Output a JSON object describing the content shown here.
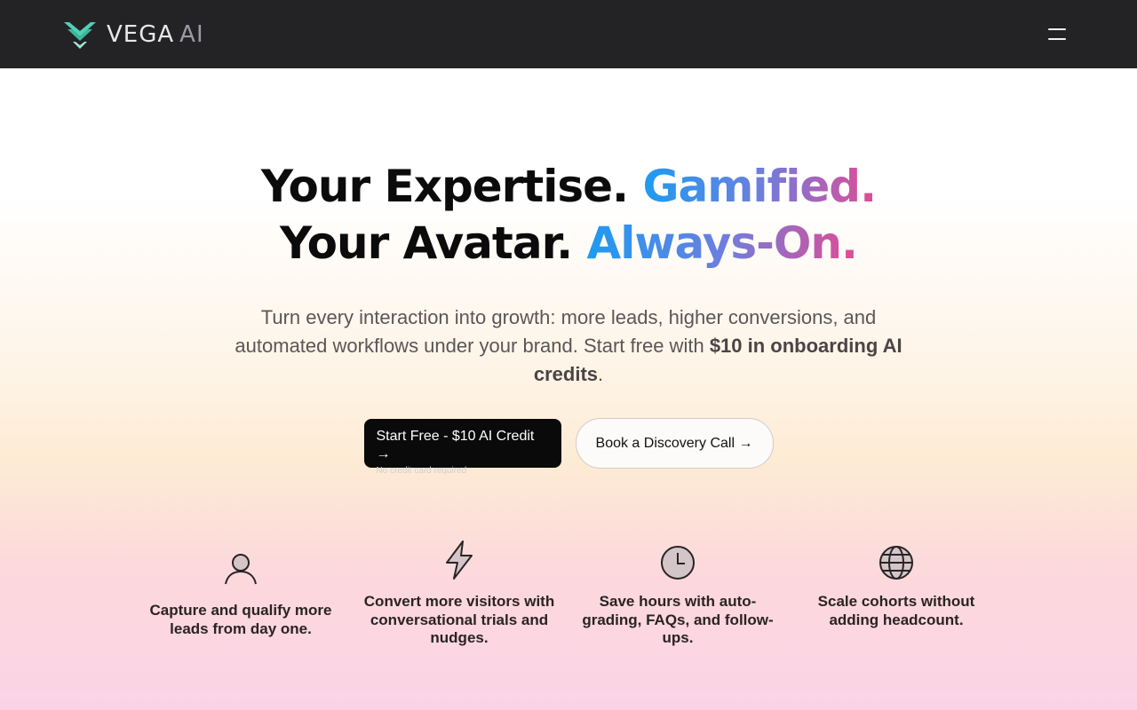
{
  "nav": {
    "brand_main": "VEGA",
    "brand_suffix": "AI"
  },
  "hero": {
    "line1_prefix": "Your Expertise.",
    "line1_highlight": "Gamified.",
    "line2_prefix": "Your Avatar.",
    "line2_highlight": "Always-On.",
    "sub_text": "Turn every interaction into growth: more leads, higher conversions, and automated workflows under your brand. Start free with",
    "sub_bold": "$10 in onboarding AI credits",
    "sub_end": "."
  },
  "cta": {
    "primary_label": "Start Free - $10 AI Credit →",
    "primary_note": "No credit card required",
    "secondary_label": "Book a Discovery Call →"
  },
  "features": [
    {
      "icon": "user-icon",
      "text": "Capture and qualify more leads from day one."
    },
    {
      "icon": "lightning-icon",
      "text": "Convert more visitors with conversational trials and nudges."
    },
    {
      "icon": "clock-icon",
      "text": "Save hours with auto-grading, FAQs, and follow-ups."
    },
    {
      "icon": "globe-icon",
      "text": "Scale cohorts without adding headcount."
    }
  ],
  "colors": {
    "nav_bg": "#232326",
    "logo_accent": "#4fd1b5",
    "gradient_start": "#1d9bf0",
    "gradient_end": "#e24b93"
  }
}
